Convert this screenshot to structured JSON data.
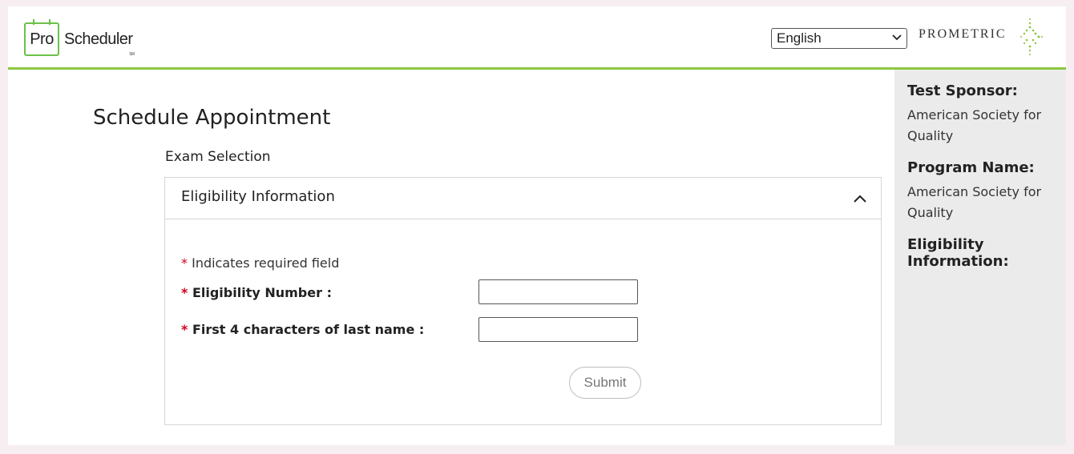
{
  "header": {
    "logo_pro": "Pro",
    "logo_scheduler": "Scheduler",
    "logo_sm": "SM",
    "language_selected": "English",
    "brand": "PROMETRIC"
  },
  "main": {
    "title": "Schedule Appointment",
    "section": "Exam Selection",
    "panel": {
      "title": "Eligibility Information",
      "required_marker": "*",
      "required_note": "Indicates required field",
      "fields": [
        {
          "label": "Eligibility Number :",
          "value": ""
        },
        {
          "label": "First 4 characters of last name :",
          "value": ""
        }
      ],
      "submit_label": "Submit"
    }
  },
  "sidebar": {
    "sponsor_heading": "Test Sponsor:",
    "sponsor_value": "American Society for Quality",
    "program_heading": "Program Name:",
    "program_value": "American Society for Quality",
    "eligibility_heading": "Eligibility Information:"
  },
  "colors": {
    "accent_green": "#8cc63f",
    "required_red": "#d0021b",
    "sidebar_bg": "#ebebeb"
  },
  "icons": {
    "collapse": "chevron-up-icon",
    "dropdown": "chevron-down-icon",
    "brand_mark": "prometric-burst-icon"
  }
}
